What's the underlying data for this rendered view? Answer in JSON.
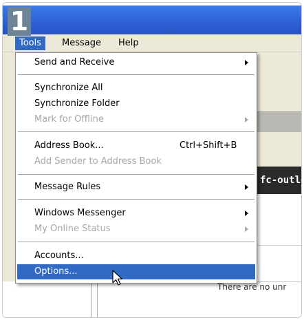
{
  "step": "1",
  "menubar": {
    "tools": "Tools",
    "message": "Message",
    "help": "Help"
  },
  "background": {
    "dark_bar_text": "fc-outlo",
    "lower_text": "There are no unr"
  },
  "menu": {
    "items": [
      {
        "label": "Send and Receive",
        "submenu": true,
        "enabled": true
      },
      {
        "label": "Synchronize All",
        "enabled": true
      },
      {
        "label": "Synchronize Folder",
        "enabled": true
      },
      {
        "label": "Mark for Offline",
        "submenu": true,
        "enabled": false
      },
      {
        "label": "Address Book...",
        "shortcut": "Ctrl+Shift+B",
        "enabled": true
      },
      {
        "label": "Add Sender to Address Book",
        "enabled": false
      },
      {
        "label": "Message Rules",
        "submenu": true,
        "enabled": true
      },
      {
        "label": "Windows Messenger",
        "submenu": true,
        "enabled": true
      },
      {
        "label": "My Online Status",
        "submenu": true,
        "enabled": false
      },
      {
        "label": "Accounts...",
        "enabled": true
      },
      {
        "label": "Options...",
        "enabled": true,
        "selected": true
      }
    ]
  },
  "colors": {
    "highlight": "#316ac5",
    "menubar_bg": "#ece9d8",
    "title_bar": "#2f63d8",
    "step_badge": "#6f8397",
    "disabled_text": "#a7a6aa"
  },
  "icons": {
    "cursor": "arrow-cursor-icon",
    "submenu_arrow": "chevron-right-icon"
  }
}
